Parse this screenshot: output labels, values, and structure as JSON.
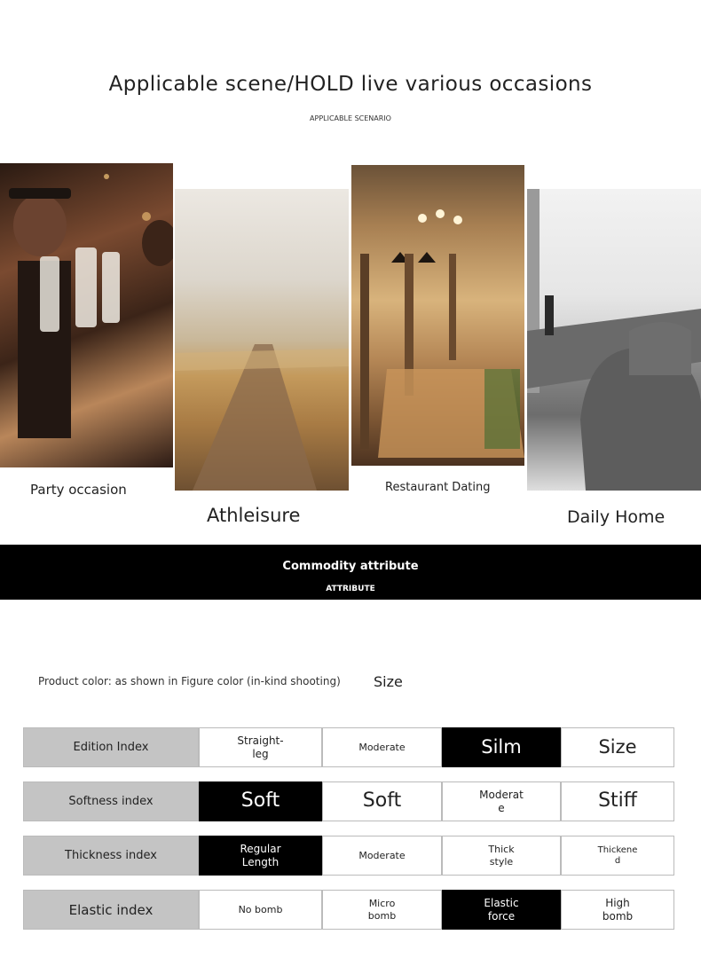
{
  "header": {
    "title": "Applicable scene/HOLD live various occasions",
    "subtitle": "APPLICABLE SCENARIO"
  },
  "scenes": [
    {
      "label": "Party occasion"
    },
    {
      "label": "Athleisure"
    },
    {
      "label": "Restaurant Dating"
    },
    {
      "label": "Daily Home"
    }
  ],
  "attribute_band": {
    "title": "Commodity attribute",
    "subtitle": "ATTRIBUTE"
  },
  "product": {
    "color_text": "Product color: as shown in Figure color (in-kind shooting)",
    "size_label": "Size"
  },
  "table": {
    "rows": [
      {
        "label": "Edition Index",
        "cells": [
          "Straight-\nleg",
          "Moderate",
          "Silm",
          "Size"
        ],
        "selected": 2
      },
      {
        "label": "Softness index",
        "cells": [
          "Soft",
          "Soft",
          "Moderat\ne",
          "Stiff"
        ],
        "selected": 0
      },
      {
        "label": "Thickness index",
        "cells": [
          "Regular\nLength",
          "Moderate",
          "Thick\nstyle",
          "Thickene\nd"
        ],
        "selected": 0
      },
      {
        "label": "Elastic index",
        "cells": [
          "No bomb",
          "Micro\nbomb",
          "Elastic\nforce",
          "High\nbomb"
        ],
        "selected": 2
      }
    ]
  }
}
